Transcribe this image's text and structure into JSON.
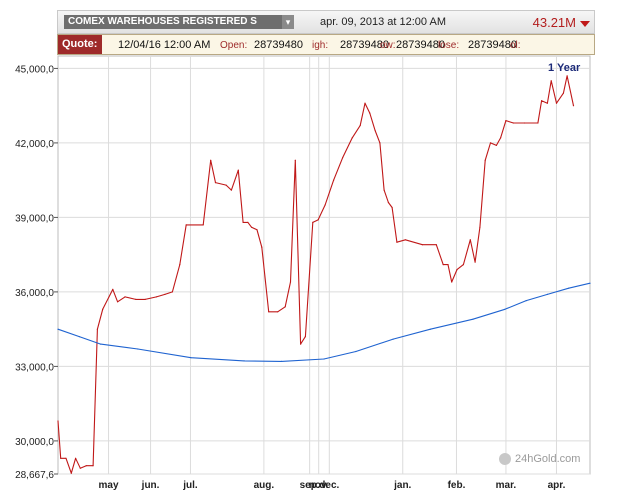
{
  "header": {
    "series_name": "COMEX WAREHOUSES REGISTERED S",
    "dropdown_glyph": "▾",
    "datetime": "apr. 09, 2013 at 12:00 AM",
    "last_value": "43.21M",
    "trend_icon": "down-triangle-icon"
  },
  "quote": {
    "label": "Quote:",
    "date": "12/04/16 12:00 AM",
    "open_label": "Open:",
    "open_value": "28739480",
    "high_label": "igh:",
    "high_value": "28739480",
    "low_label": "ow:",
    "low_value": "28739480",
    "close_label": "lose:",
    "close_value": "28739480",
    "vol_label": "ol:"
  },
  "period": "1 Year",
  "watermark": "24hGold.com",
  "colors": {
    "price": "#c01818",
    "moving_average": "#1f63d0",
    "grid": "#dcdcdc",
    "header_accent": "#9e2a2a"
  },
  "chart_data": {
    "type": "line",
    "title": "",
    "xlabel": "",
    "ylabel": "",
    "ylim": [
      28667,
      45500
    ],
    "xlim": [
      0,
      100
    ],
    "y_ticks": [
      {
        "value": 45000,
        "label": "45,000,0"
      },
      {
        "value": 42000,
        "label": "42,000,0"
      },
      {
        "value": 39000,
        "label": "39,000,0"
      },
      {
        "value": 36000,
        "label": "36,000,0"
      },
      {
        "value": 33000,
        "label": "33,000,0"
      },
      {
        "value": 30000,
        "label": "30,000,0"
      },
      {
        "value": 28667,
        "label": "28,667,6"
      }
    ],
    "x_ticks": [
      {
        "value": 9.5,
        "label": "may"
      },
      {
        "value": 17.4,
        "label": "jun."
      },
      {
        "value": 24.9,
        "label": "jul."
      },
      {
        "value": 38.7,
        "label": "aug."
      },
      {
        "value": 47.3,
        "label": "sep."
      },
      {
        "value": 49.0,
        "label": "nov."
      },
      {
        "value": 51.0,
        "label": "dec."
      },
      {
        "value": 64.8,
        "label": "jan."
      },
      {
        "value": 74.9,
        "label": "feb."
      },
      {
        "value": 84.2,
        "label": "mar."
      },
      {
        "value": 93.7,
        "label": "apr."
      }
    ],
    "grid": true,
    "legend": "none",
    "series": [
      {
        "values": [
          [
            0,
            30800
          ],
          [
            0.5,
            29300
          ],
          [
            1.5,
            29300
          ],
          [
            2.5,
            28700
          ],
          [
            3.3,
            29300
          ],
          [
            4.2,
            28900
          ],
          [
            5.3,
            29000
          ],
          [
            6.6,
            29000
          ],
          [
            7.4,
            34500
          ],
          [
            8.4,
            35300
          ],
          [
            10.3,
            36100
          ],
          [
            11.2,
            35600
          ],
          [
            12.6,
            35800
          ],
          [
            14.6,
            35700
          ],
          [
            16.4,
            35700
          ],
          [
            18.5,
            35800
          ],
          [
            20.1,
            35900
          ],
          [
            21.5,
            36000
          ],
          [
            22.9,
            37100
          ],
          [
            24.1,
            38700
          ],
          [
            27.3,
            38700
          ],
          [
            28.7,
            41300
          ],
          [
            29.6,
            40400
          ],
          [
            31.6,
            40300
          ],
          [
            32.6,
            40100
          ],
          [
            33.9,
            40900
          ],
          [
            34.8,
            38800
          ],
          [
            35.7,
            38800
          ],
          [
            36.4,
            38600
          ],
          [
            37.4,
            38500
          ],
          [
            38.3,
            37800
          ],
          [
            39.6,
            35200
          ],
          [
            41.3,
            35200
          ],
          [
            42.7,
            35400
          ],
          [
            43.7,
            36400
          ],
          [
            44.6,
            41300
          ],
          [
            45.6,
            33900
          ],
          [
            46.5,
            34200
          ],
          [
            47.9,
            38800
          ],
          [
            48.9,
            38900
          ],
          [
            50.2,
            39500
          ],
          [
            51.8,
            40500
          ],
          [
            53.5,
            41400
          ],
          [
            55.3,
            42200
          ],
          [
            56.8,
            42700
          ],
          [
            57.7,
            43600
          ],
          [
            58.6,
            43200
          ],
          [
            59.6,
            42500
          ],
          [
            60.5,
            42000
          ],
          [
            61.3,
            40100
          ],
          [
            62.1,
            39600
          ],
          [
            62.8,
            39400
          ],
          [
            63.7,
            38000
          ],
          [
            65.3,
            38100
          ],
          [
            68.5,
            37900
          ],
          [
            71.1,
            37900
          ],
          [
            72.4,
            37100
          ],
          [
            73.3,
            37100
          ],
          [
            74.0,
            36400
          ],
          [
            75.0,
            36900
          ],
          [
            76.2,
            37100
          ],
          [
            77.5,
            38100
          ],
          [
            78.4,
            37200
          ],
          [
            79.3,
            38600
          ],
          [
            80.3,
            41300
          ],
          [
            81.3,
            42000
          ],
          [
            82.4,
            41900
          ],
          [
            83.2,
            42200
          ],
          [
            84.2,
            42900
          ],
          [
            85.6,
            42800
          ],
          [
            87.7,
            42800
          ],
          [
            90.2,
            42800
          ],
          [
            90.9,
            43700
          ],
          [
            92.0,
            43600
          ],
          [
            92.7,
            44500
          ],
          [
            93.7,
            43600
          ],
          [
            95.0,
            44000
          ],
          [
            95.7,
            44700
          ],
          [
            96.9,
            43500
          ]
        ],
        "color": "#c01818"
      },
      {
        "values": [
          [
            0,
            34500
          ],
          [
            4,
            34200
          ],
          [
            8,
            33900
          ],
          [
            15,
            33700
          ],
          [
            25,
            33350
          ],
          [
            35,
            33220
          ],
          [
            42,
            33200
          ],
          [
            50,
            33300
          ],
          [
            56,
            33600
          ],
          [
            63,
            34100
          ],
          [
            70,
            34500
          ],
          [
            78,
            34900
          ],
          [
            84,
            35300
          ],
          [
            88,
            35650
          ],
          [
            92,
            35900
          ],
          [
            96,
            36150
          ],
          [
            100,
            36350
          ]
        ],
        "color": "#1f63d0"
      }
    ]
  }
}
